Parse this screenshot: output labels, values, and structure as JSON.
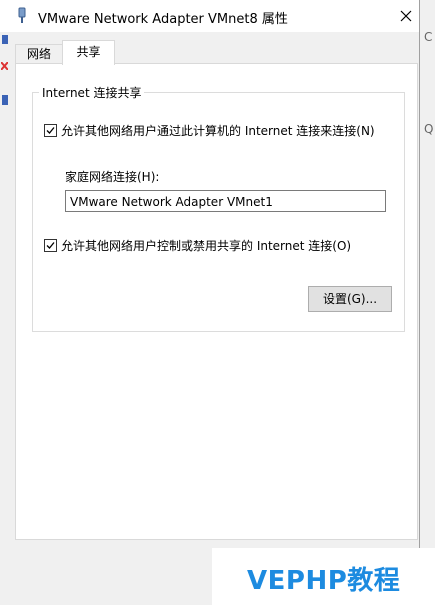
{
  "window": {
    "title": "VMware Network Adapter VMnet8 属性",
    "icon": "network-adapter-icon",
    "close_icon": "close-icon"
  },
  "tabs": [
    {
      "label": "网络",
      "active": false
    },
    {
      "label": "共享",
      "active": true
    }
  ],
  "sharing": {
    "group_title": "Internet 连接共享",
    "allow_connect": {
      "label": "允许其他网络用户通过此计算机的 Internet 连接来连接(N)",
      "checked": true
    },
    "home_network_label": "家庭网络连接(H):",
    "home_network_value": "VMware Network Adapter VMnet1",
    "allow_control": {
      "label": "允许其他网络用户控制或禁用共享的 Internet 连接(O)",
      "checked": true
    },
    "settings_button": "设置(G)..."
  },
  "background": {
    "right_edge_q": "Q",
    "right_edge_c": "C"
  },
  "watermark": "VEPHP教程",
  "colors": {
    "accent": "#1d8be0",
    "window_bg": "#f0f0f0",
    "panel_bg": "#ffffff"
  }
}
